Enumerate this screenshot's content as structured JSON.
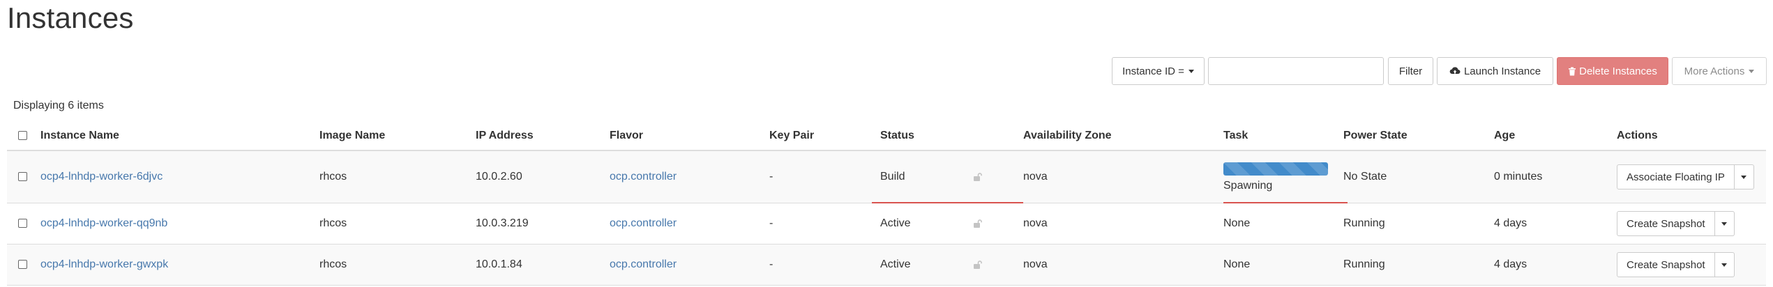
{
  "page": {
    "title": "Instances"
  },
  "toolbar": {
    "filter_field_label": "Instance ID =",
    "filter_input_value": "",
    "filter_button": "Filter",
    "launch_button": "Launch Instance",
    "delete_button": "Delete Instances",
    "more_actions_button": "More Actions"
  },
  "table": {
    "count_text": "Displaying 6 items",
    "headers": {
      "name": "Instance Name",
      "image": "Image Name",
      "ip": "IP Address",
      "flavor": "Flavor",
      "keypair": "Key Pair",
      "status": "Status",
      "az": "Availability Zone",
      "task": "Task",
      "power": "Power State",
      "age": "Age",
      "actions": "Actions"
    },
    "rows": [
      {
        "name": "ocp4-lnhdp-worker-6djvc",
        "image": "rhcos",
        "ip": "10.0.2.60",
        "flavor": "ocp.controller",
        "keypair": "-",
        "status": "Build",
        "az": "nova",
        "task": "Spawning",
        "task_progress": 1.0,
        "power": "No State",
        "age": "0 minutes",
        "action": "Associate Floating IP"
      },
      {
        "name": "ocp4-lnhdp-worker-qq9nb",
        "image": "rhcos",
        "ip": "10.0.3.219",
        "flavor": "ocp.controller",
        "keypair": "-",
        "status": "Active",
        "az": "nova",
        "task": "None",
        "power": "Running",
        "age": "4 days",
        "action": "Create Snapshot"
      },
      {
        "name": "ocp4-lnhdp-worker-gwxpk",
        "image": "rhcos",
        "ip": "10.0.1.84",
        "flavor": "ocp.controller",
        "keypair": "-",
        "status": "Active",
        "az": "nova",
        "task": "None",
        "power": "Running",
        "age": "4 days",
        "action": "Create Snapshot"
      }
    ]
  },
  "icons": {
    "launch": "cloud-upload-icon",
    "delete": "trash-icon",
    "lock": "unlock-icon"
  },
  "colors": {
    "link": "#4778ac",
    "danger": "#e2807f",
    "progress": "#428bca",
    "status_underline": "#d9534f"
  }
}
